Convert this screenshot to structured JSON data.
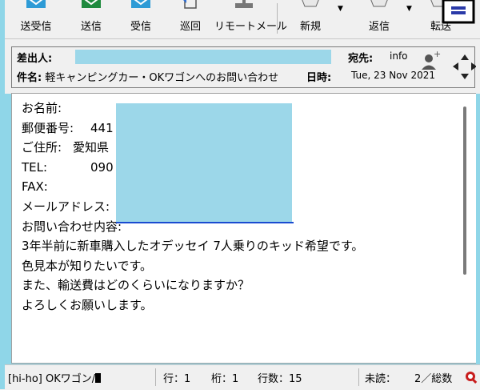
{
  "toolbar": {
    "buttons": [
      {
        "label": "送受信",
        "icon": "send-receive-icon"
      },
      {
        "label": "送信",
        "icon": "send-icon"
      },
      {
        "label": "受信",
        "icon": "receive-icon"
      },
      {
        "label": "巡回",
        "icon": "patrol-icon"
      },
      {
        "label": "リモートメール",
        "icon": "remote-mail-icon"
      },
      {
        "label": "新規",
        "icon": "new-mail-icon"
      },
      {
        "label": "返信",
        "icon": "reply-icon"
      },
      {
        "label": "転送",
        "icon": "forward-icon"
      }
    ],
    "drop_glyph": "▼"
  },
  "header": {
    "from_label": "差出人:",
    "subject_label": "件名:",
    "subject": "軽キャンピングカー・OKワゴンへのお問い合わせ",
    "to_label": "宛先:",
    "to_value": "info",
    "date_label": "日時:",
    "date_value": "Tue, 23 Nov 2021"
  },
  "body": {
    "name_label": "お名前:",
    "zip_label": "郵便番号:",
    "zip_value": "441",
    "address_label": "ご住所:",
    "address_value": "愛知県",
    "tel_label": "TEL:",
    "tel_value": "090",
    "fax_label": "FAX:",
    "email_label": "メールアドレス:",
    "inquiry_label": "お問い合わせ内容:",
    "line1": "3年半前に新車購入したオデッセイ 7人乗りのキッド希望です。",
    "line2": "色見本が知りたいです。",
    "line3": "また、輸送費はどのくらいになりますか？",
    "line4": "よろしくお願いします。"
  },
  "status": {
    "folder": "[hi-ho] OKワゴン/",
    "line": "行：1",
    "col": "桁：1",
    "rows": "行数：15",
    "unread": "未読：",
    "total": "2／総数"
  },
  "colors": {
    "mask": "#9cd7e9",
    "accent": "#1a4bd0"
  }
}
